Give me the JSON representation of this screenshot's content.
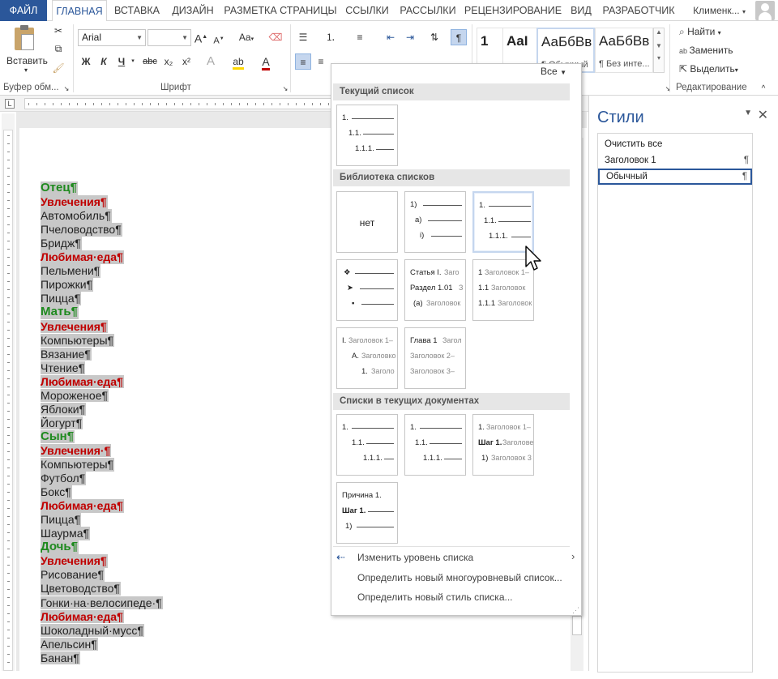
{
  "tabs": [
    "ФАЙЛ",
    "ГЛАВНАЯ",
    "ВСТАВКА",
    "ДИЗАЙН",
    "РАЗМЕТКА СТРАНИЦЫ",
    "ССЫЛКИ",
    "РАССЫЛКИ",
    "РЕЦЕНЗИРОВАНИЕ",
    "ВИД",
    "РАЗРАБОТЧИК"
  ],
  "user": "Клименк...",
  "ribbon": {
    "paste_label": "Вставить",
    "clipboard_label": "Буфер обм...",
    "font_label": "Шрифт",
    "font_name": "Arial",
    "font_size": "",
    "edit_label": "Редактирование",
    "find": "Найти",
    "replace": "Заменить",
    "select": "Выделить",
    "bold": "Ж",
    "italic": "К",
    "underline": "Ч",
    "strike": "abc",
    "subscript": "x₂",
    "superscript": "x²",
    "case_btn": "Aa",
    "styles": [
      {
        "preview": "1",
        "name": ""
      },
      {
        "preview": "AaI",
        "name": ""
      },
      {
        "preview": "АаБбВв",
        "name": "¶ Обычный"
      },
      {
        "preview": "АаБбВв",
        "name": "¶ Без инте..."
      }
    ]
  },
  "document_lines": [
    {
      "text": "Отец¶",
      "style": "h1"
    },
    {
      "text": "Увлечения¶",
      "style": "h2"
    },
    {
      "text": "Автомобиль¶",
      "style": "n"
    },
    {
      "text": "Пчеловодство¶",
      "style": "n"
    },
    {
      "text": "Бридж¶",
      "style": "n"
    },
    {
      "text": "Любимая·еда¶",
      "style": "h2"
    },
    {
      "text": "Пельмени¶",
      "style": "n"
    },
    {
      "text": "Пирожки¶",
      "style": "n"
    },
    {
      "text": "Пицца¶",
      "style": "n"
    },
    {
      "text": "Мать¶",
      "style": "h1"
    },
    {
      "text": "Увлечения¶",
      "style": "h2"
    },
    {
      "text": "Компьютеры¶",
      "style": "n"
    },
    {
      "text": "Вязание¶",
      "style": "n"
    },
    {
      "text": "Чтение¶",
      "style": "n"
    },
    {
      "text": "Любимая·еда¶",
      "style": "h2"
    },
    {
      "text": "Мороженое¶",
      "style": "n"
    },
    {
      "text": "Яблоки¶",
      "style": "n"
    },
    {
      "text": "Йогурт¶",
      "style": "n"
    },
    {
      "text": "Сын¶",
      "style": "h1"
    },
    {
      "text": "Увлечения·¶",
      "style": "h2"
    },
    {
      "text": "Компьютеры¶",
      "style": "n"
    },
    {
      "text": "Футбол¶",
      "style": "n"
    },
    {
      "text": "Бокс¶",
      "style": "n"
    },
    {
      "text": "Любимая·еда¶",
      "style": "h2"
    },
    {
      "text": "Пицца¶",
      "style": "n"
    },
    {
      "text": "Шаурма¶",
      "style": "n"
    },
    {
      "text": "Дочь¶",
      "style": "h1"
    },
    {
      "text": "Увлечения¶",
      "style": "h2"
    },
    {
      "text": "Рисование¶",
      "style": "n"
    },
    {
      "text": "Цветоводство¶",
      "style": "n"
    },
    {
      "text": "Гонки·на·велосипеде·¶",
      "style": "n"
    },
    {
      "text": "Любимая·еда¶",
      "style": "h2"
    },
    {
      "text": "Шоколадный·мусс¶",
      "style": "n"
    },
    {
      "text": "Апельсин¶",
      "style": "n"
    },
    {
      "text": "Банан¶",
      "style": "n"
    }
  ],
  "panel": {
    "all_label": "Все",
    "section_current": "Текущий список",
    "section_library": "Библиотека списков",
    "section_docs": "Списки в текущих документах",
    "none_label": "нет",
    "menu": [
      {
        "label": "Изменить уровень списка",
        "arrow": "›"
      },
      {
        "label": "Определить новый многоуровневый список..."
      },
      {
        "label": "Определить новый стиль списка..."
      }
    ],
    "thumbs": {
      "num3": [
        "1.",
        "1.1.",
        "1.1.1."
      ],
      "paren": [
        "1)",
        "a)",
        "i)"
      ],
      "art": [
        "Статья I.",
        "Заго",
        "Раздел 1.01",
        "З",
        "(a)",
        "Заголовок"
      ],
      "hnum": [
        "1",
        "Заголовок 1–",
        "1.1",
        "Заголовок",
        "1.1.1",
        "Заголовок"
      ],
      "roman": [
        "I.",
        "Заголовок 1–",
        "A.",
        "Заголовко",
        "1.",
        "Заголо"
      ],
      "chap": [
        "Глава 1",
        "Загол",
        "Заголовок 2–",
        "Заголовок 3–"
      ],
      "doc3": [
        "1.",
        "Заголовок 1–",
        "Шаг 1.",
        "Заголове",
        "1)",
        "Заголовок 3"
      ],
      "doc4": [
        "Причина 1.",
        "Шаг 1.",
        "1)"
      ]
    }
  },
  "styles_pane": {
    "title": "Стили",
    "items": [
      {
        "label": "Очистить все",
        "mark": ""
      },
      {
        "label": "Заголовок 1",
        "mark": "¶"
      },
      {
        "label": "Обычный",
        "mark": "¶"
      }
    ]
  }
}
